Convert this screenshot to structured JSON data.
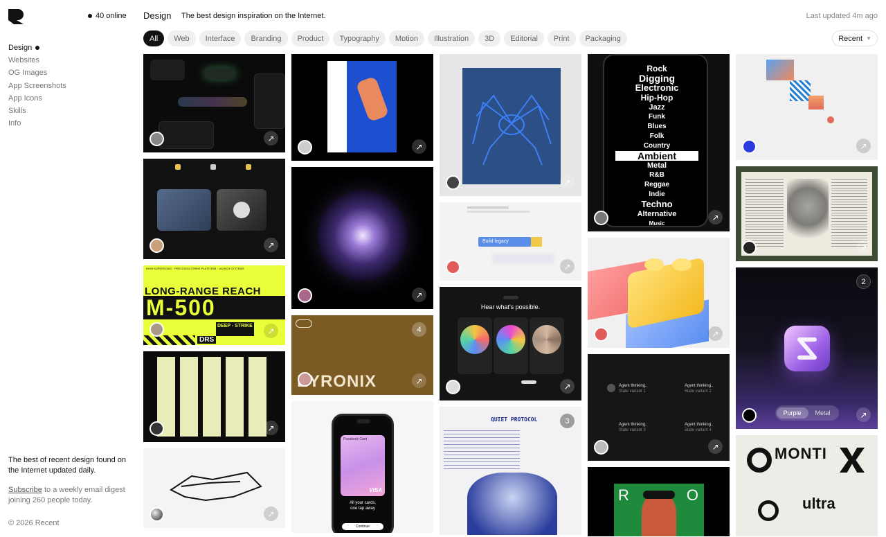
{
  "sidebar": {
    "online_count": "40 online",
    "nav": [
      {
        "label": "Design",
        "active": true
      },
      {
        "label": "Websites"
      },
      {
        "label": "OG Images"
      },
      {
        "label": "App Screenshots"
      },
      {
        "label": "App Icons"
      },
      {
        "label": "Skills"
      },
      {
        "label": "Info"
      }
    ],
    "tagline": "The best of recent design found on the Internet updated daily.",
    "subscribe_link": "Subscribe",
    "subscribe_rest": " to a weekly email digest joining 260 people today.",
    "copyright": "© 2026 Recent"
  },
  "header": {
    "title": "Design",
    "description": "The best design inspiration on the Internet.",
    "updated": "Last updated 4m ago"
  },
  "filters": [
    "All",
    "Web",
    "Interface",
    "Branding",
    "Product",
    "Typography",
    "Motion",
    "Illustration",
    "3D",
    "Editorial",
    "Print",
    "Packaging"
  ],
  "sort": {
    "label": "Recent",
    "icon": "chevron-down-icon"
  },
  "cards": {
    "c3": {
      "text": "LONG-RANGE REACH",
      "big": "M-500",
      "tag": "DRS",
      "sub": "DEEP - STRIKE",
      "head": "HIGH SUPERSONIC · PRECISION STRIKE PLATFORM · LAUNCH SYSTEMS"
    },
    "c4": {
      "text": "EYRONIX",
      "count": "4"
    },
    "c5": {
      "title": "Hear what's possible."
    },
    "c6": {
      "button": "Build legacy"
    },
    "c7": {
      "count": "3",
      "title": "QUIET PROTOCOL"
    },
    "c8": {
      "agent": "Agent thinking..",
      "state1": "State variant 1",
      "state2": "State variant 2",
      "state3": "State variant 3",
      "state4": "State variant 4"
    },
    "c9": {
      "count": "2",
      "option_a": "Purple",
      "option_b": "Metal"
    },
    "c10": {
      "words": [
        "Rock",
        "Digging",
        "Electronic",
        "Hip-Hop",
        "Jazz",
        "Funk",
        "Blues",
        "Folk",
        "Country",
        "Ambient",
        "Metal",
        "R&B",
        "Reggae",
        "Indie",
        "Techno",
        "Alternative",
        "Music"
      ]
    },
    "c11": {
      "card_label": "Passbook Card",
      "card_brand": "VISA",
      "tagline1": "All your cards,",
      "tagline2": "one tap away",
      "button": "Continue"
    },
    "c12": {
      "left": "R",
      "right": "O"
    },
    "c13": {
      "text1": "MONTI",
      "text2": "ultra"
    }
  },
  "colors": {
    "accent": "#111111",
    "chip_bg": "#efefef",
    "muted": "#777777"
  }
}
